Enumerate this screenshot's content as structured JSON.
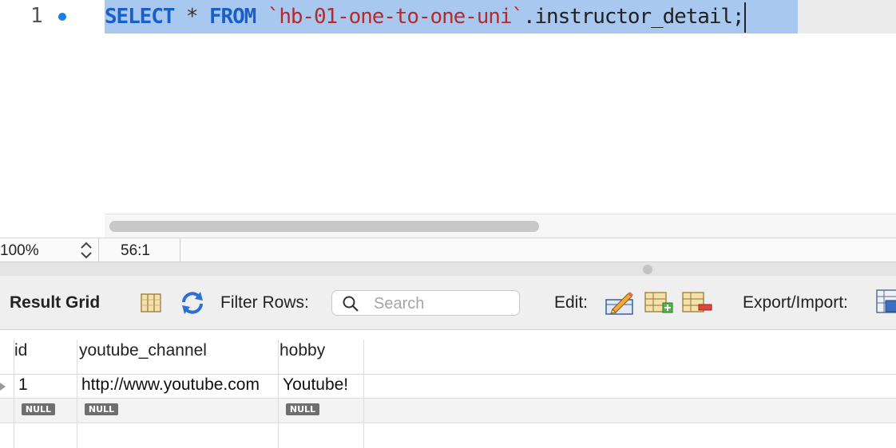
{
  "editor": {
    "line_number": "1",
    "code": {
      "kw_select": "SELECT",
      "star": " * ",
      "kw_from": "FROM",
      "schema": " `hb-01-one-to-one-uni`",
      "table": ".instructor_detail;"
    }
  },
  "status_bar": {
    "zoom": "100%",
    "cursor_position": "56:1"
  },
  "toolbar": {
    "title": "Result Grid",
    "filter_label": "Filter Rows:",
    "search_placeholder": "Search",
    "edit_label": "Edit:",
    "export_label": "Export/Import:"
  },
  "grid": {
    "columns": [
      "id",
      "youtube_channel",
      "hobby"
    ],
    "rows": [
      [
        "1",
        "http://www.youtube.com",
        "Youtube!"
      ],
      [
        "NULL",
        "NULL",
        "NULL"
      ]
    ]
  },
  "icons": {
    "breakpoint": "breakpoint-dot",
    "zoom_stepper": "chevron-updown-icon",
    "column_toggle": "columns-icon",
    "refresh": "refresh-icon",
    "search": "search-icon",
    "edit_cell": "edit-pencil-icon",
    "insert_row": "add-row-icon",
    "delete_row": "delete-row-icon",
    "export": "export-icon"
  },
  "colors": {
    "keyword": "#1a5fc8",
    "string": "#b52b2b",
    "selection": "#a8c8ef",
    "breakpoint": "#1a7fe5"
  }
}
